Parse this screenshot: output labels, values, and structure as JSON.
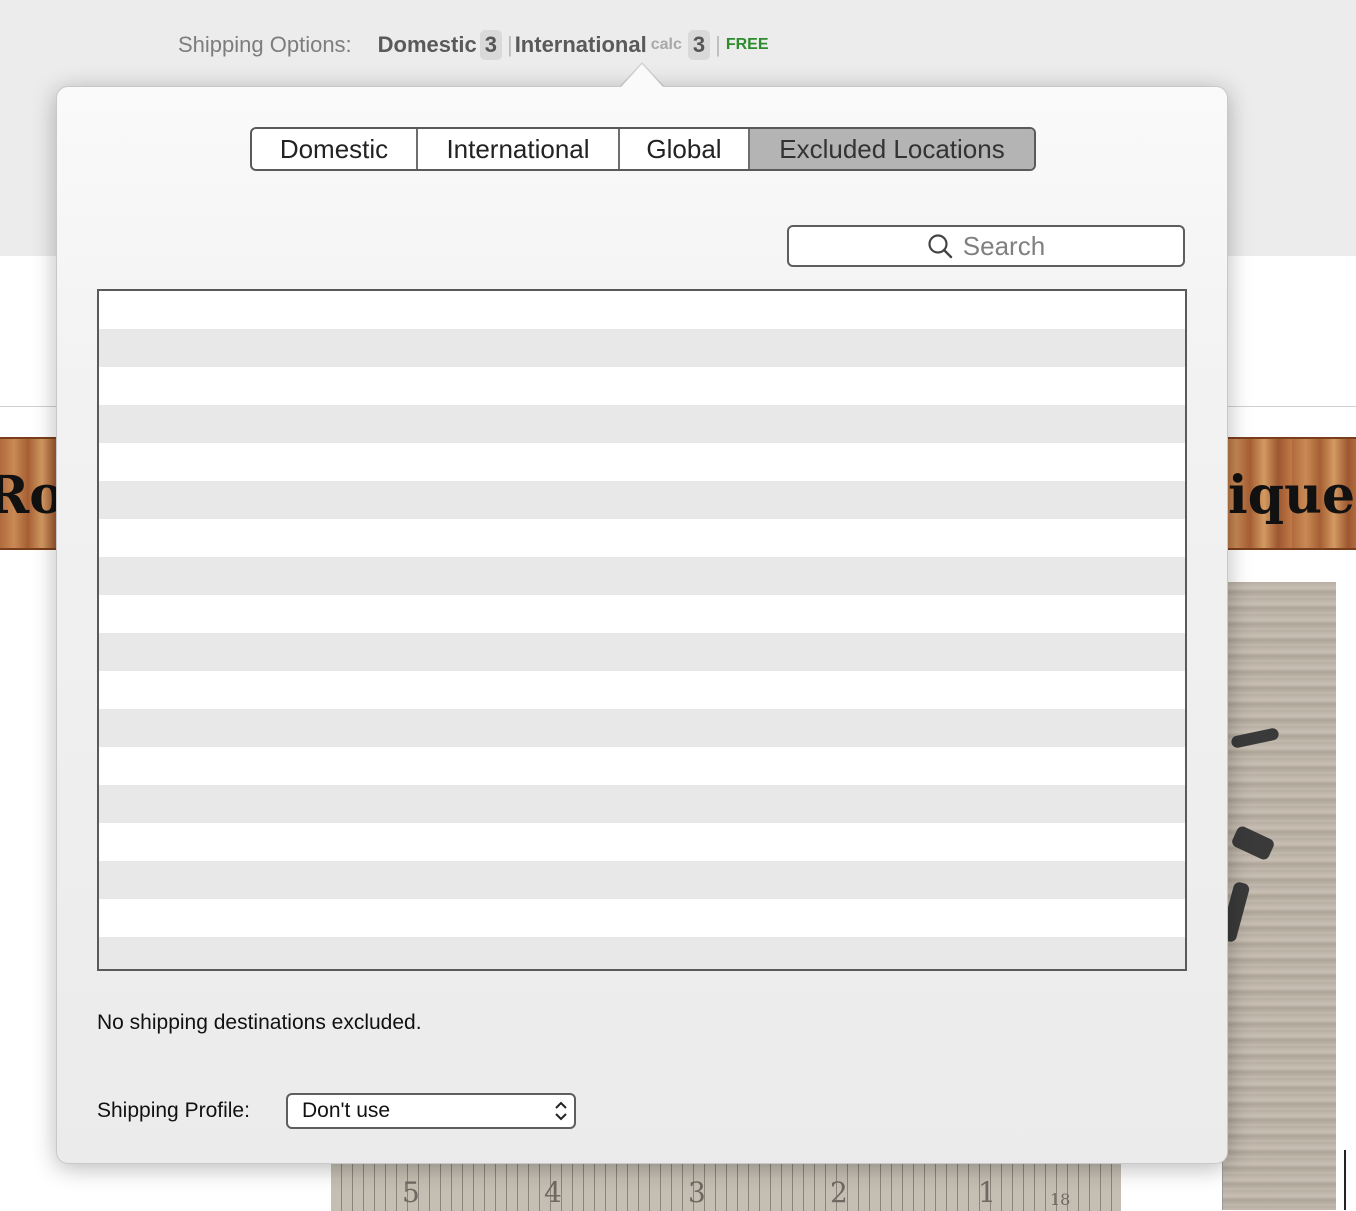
{
  "background": {
    "shipping_options": {
      "label": "Shipping Options:",
      "domestic_label": "Domestic",
      "domestic_count": "3",
      "separator": "|",
      "international_label": "International",
      "international_calc": "calc",
      "international_count": "3",
      "free_label": "FREE"
    },
    "banner": {
      "left_text": "Ros",
      "right_text": "tique"
    },
    "ruler_numbers": [
      "5",
      "4",
      "3",
      "2",
      "1",
      "18"
    ]
  },
  "popover": {
    "tabs": [
      {
        "label": "Domestic",
        "active": false
      },
      {
        "label": "International",
        "active": false
      },
      {
        "label": "Global",
        "active": false
      },
      {
        "label": "Excluded Locations",
        "active": true
      }
    ],
    "search": {
      "placeholder": "Search"
    },
    "status_text": "No shipping destinations excluded.",
    "profile": {
      "label": "Shipping Profile:",
      "selected": "Don't use"
    }
  },
  "colors": {
    "free": "#2e8b2e",
    "active_tab": "#b4b4b4",
    "row_alt": "#e8e8e8"
  }
}
